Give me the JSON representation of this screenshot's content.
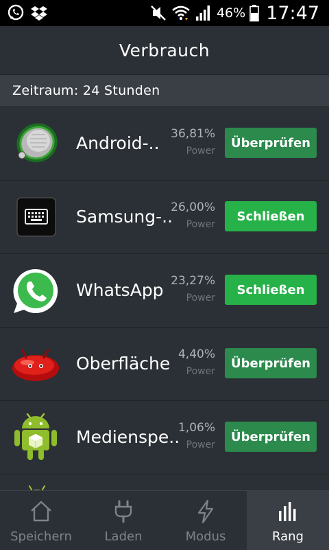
{
  "status_bar": {
    "battery_percent": "46%",
    "time": "17:47",
    "icons": [
      "whatsapp-icon",
      "dropbox-icon",
      "mute-icon",
      "wifi-icon",
      "signal-icon",
      "battery-icon"
    ]
  },
  "header": {
    "title": "Verbrauch"
  },
  "period": {
    "label": "Zeitraum: 24 Stunden"
  },
  "apps": [
    {
      "name": "Android-..",
      "percent": "36,81%",
      "unit": "Power",
      "action": "Überprüfen",
      "icon": "android-system-icon"
    },
    {
      "name": "Samsung-..",
      "percent": "26,00%",
      "unit": "Power",
      "action": "Schließen",
      "icon": "samsung-keyboard-icon"
    },
    {
      "name": "WhatsApp",
      "percent": "23,27%",
      "unit": "Power",
      "action": "Schließen",
      "icon": "whatsapp-icon"
    },
    {
      "name": "Oberfläche",
      "percent": "4,40%",
      "unit": "Power",
      "action": "Überprüfen",
      "icon": "jellybean-icon"
    },
    {
      "name": "Medienspe..",
      "percent": "1,06%",
      "unit": "Power",
      "action": "Überprüfen",
      "icon": "android-robot-icon"
    }
  ],
  "nav": [
    {
      "label": "Speichern",
      "icon": "home-icon"
    },
    {
      "label": "Laden",
      "icon": "plug-icon"
    },
    {
      "label": "Modus",
      "icon": "lightning-icon"
    },
    {
      "label": "Rang",
      "icon": "bar-chart-icon"
    }
  ],
  "colors": {
    "background": "#2b3036",
    "button_check": "#2c8a4d",
    "button_close": "#27b249",
    "status_bar": "#000000"
  }
}
